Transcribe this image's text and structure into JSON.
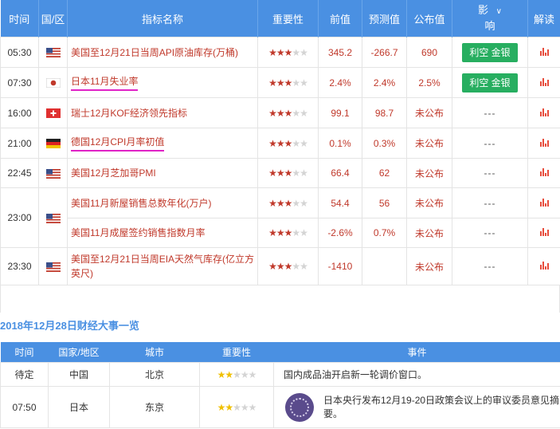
{
  "calendar": {
    "headers": {
      "time": "时间",
      "country": "国/区",
      "indicator": "指标名称",
      "importance": "重要性",
      "previous": "前值",
      "forecast": "预测值",
      "actual": "公布值",
      "impact_top": "影",
      "impact_bottom": "响",
      "analysis": "解读"
    },
    "rows": [
      {
        "time": "05:30",
        "flag": "us-flag-icon",
        "name": "美国至12月21日当周API原油库存(万桶)",
        "stars": 3,
        "prev": "345.2",
        "forecast": "-266.7",
        "actual": "690",
        "impact": "利空 金银",
        "underline": false
      },
      {
        "time": "07:30",
        "flag": "jp-flag-icon",
        "name": "日本11月失业率",
        "stars": 3,
        "prev": "2.4%",
        "forecast": "2.4%",
        "actual": "2.5%",
        "impact": "利空 金银",
        "underline": true
      },
      {
        "time": "16:00",
        "flag": "ch-flag-icon",
        "name": "瑞士12月KOF经济领先指标",
        "stars": 3,
        "prev": "99.1",
        "forecast": "98.7",
        "actual": "未公布",
        "impact": "---",
        "underline": false
      },
      {
        "time": "21:00",
        "flag": "de-flag-icon",
        "name": "德国12月CPI月率初值",
        "stars": 3,
        "prev": "0.1%",
        "forecast": "0.3%",
        "actual": "未公布",
        "impact": "---",
        "underline": true
      },
      {
        "time": "22:45",
        "flag": "us-flag-icon",
        "name": "美国12月芝加哥PMI",
        "stars": 3,
        "prev": "66.4",
        "forecast": "62",
        "actual": "未公布",
        "impact": "---",
        "underline": false
      },
      {
        "time": "23:00",
        "flag": "us-flag-icon",
        "name": "美国11月新屋销售总数年化(万户)",
        "stars": 3,
        "prev": "54.4",
        "forecast": "56",
        "actual": "未公布",
        "impact": "---",
        "underline": false
      },
      {
        "time": "",
        "flag": "",
        "name": "美国11月成屋签约销售指数月率",
        "stars": 3,
        "prev": "-2.6%",
        "forecast": "0.7%",
        "actual": "未公布",
        "impact": "---",
        "underline": false
      },
      {
        "time": "23:30",
        "flag": "us-flag-icon",
        "name": "美国至12月21日当周EIA天然气库存(亿立方英尺)",
        "stars": 3,
        "prev": "-1410",
        "forecast": "",
        "actual": "未公布",
        "impact": "---",
        "underline": false
      }
    ]
  },
  "events": {
    "title": "2018年12月28日财经大事一览",
    "headers": {
      "time": "时间",
      "country": "国家/地区",
      "city": "城市",
      "importance": "重要性",
      "event": "事件"
    },
    "rows": [
      {
        "time": "待定",
        "country": "中国",
        "city": "北京",
        "stars": 2,
        "event": "国内成品油开启新一轮调价窗口。",
        "seal": false
      },
      {
        "time": "07:50",
        "country": "日本",
        "city": "东京",
        "stars": 2,
        "event": "日本央行发布12月19-20日政策会议上的审议委员意见摘要。",
        "seal": true
      }
    ]
  },
  "colors": {
    "header_blue": "#4a90e2",
    "accent_red": "#c0392b",
    "button_green": "#27ae60",
    "underline_magenta": "#e023c6"
  }
}
